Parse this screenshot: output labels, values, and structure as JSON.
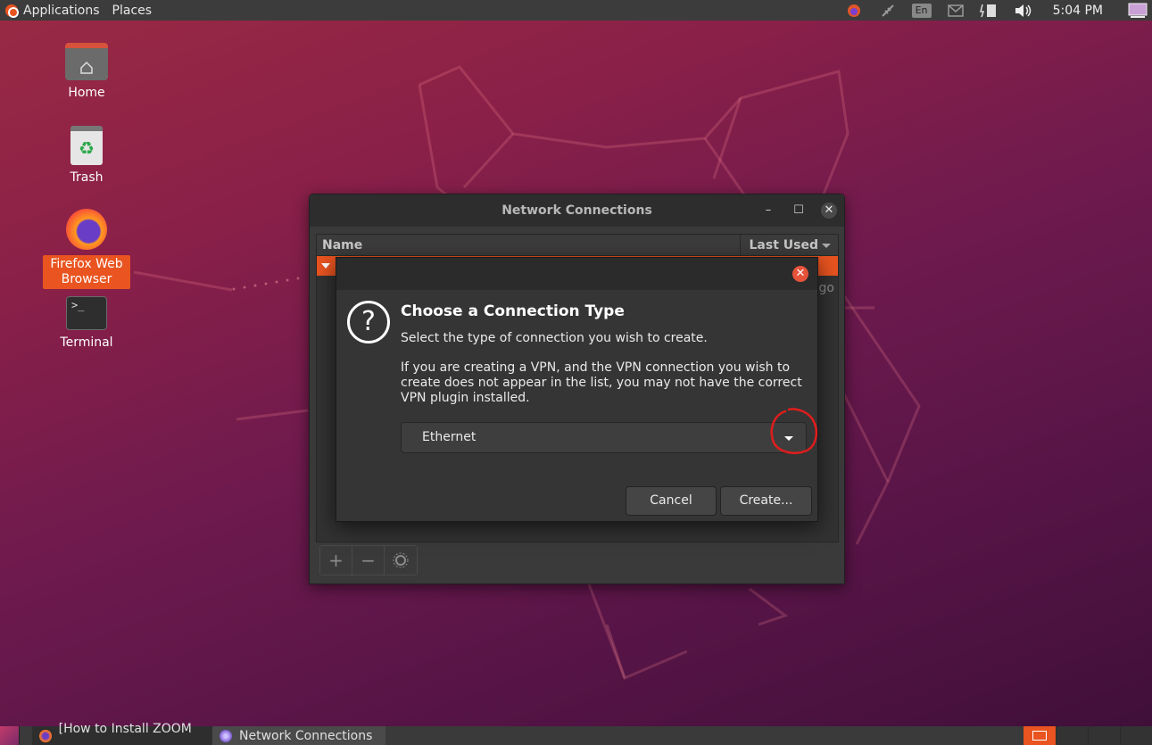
{
  "top_panel": {
    "applications_label": "Applications",
    "places_label": "Places",
    "keyboard_layout": "En",
    "clock": "5:04 PM"
  },
  "desktop": {
    "icons": [
      {
        "label": "Home"
      },
      {
        "label": "Trash"
      },
      {
        "label": "Firefox Web Browser"
      },
      {
        "label": "Terminal"
      }
    ]
  },
  "nm_window": {
    "title": "Network Connections",
    "columns": {
      "name": "Name",
      "last_used": "Last Used"
    },
    "partial_last_used": "go",
    "toolbar": {
      "add": "+",
      "remove": "−"
    }
  },
  "dialog": {
    "heading": "Choose a Connection Type",
    "text1": "Select the type of connection you wish to create.",
    "text2": "If you are creating a VPN, and the VPN connection you wish to create does not appear in the list, you may not have the correct VPN plugin installed.",
    "combo_value": "Ethernet",
    "cancel_label": "Cancel",
    "create_label": "Create..."
  },
  "taskbar": {
    "tasks": [
      {
        "label": "[How to Install ZOOM ..."
      },
      {
        "label": "Network Connections"
      }
    ]
  },
  "colors": {
    "accent": "#e95420",
    "annotation": "#e01d1d"
  }
}
